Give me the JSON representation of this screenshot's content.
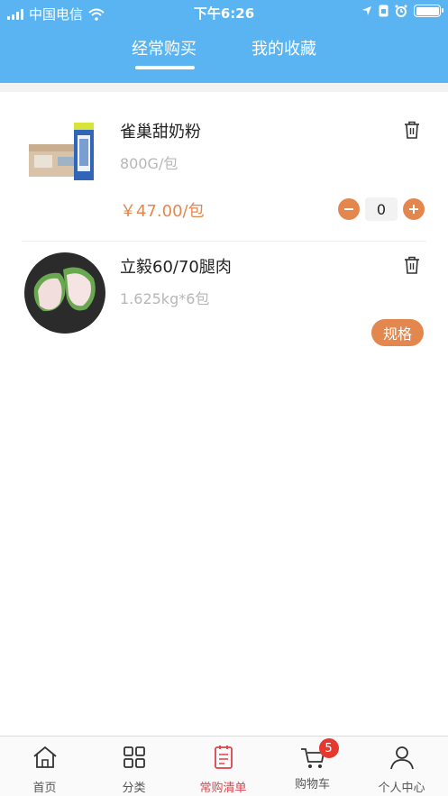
{
  "status_bar": {
    "carrier": "中国电信",
    "time": "下午6:26"
  },
  "tabs": [
    {
      "label": "经常购买",
      "active": true
    },
    {
      "label": "我的收藏",
      "active": false
    }
  ],
  "products": [
    {
      "name": "雀巢甜奶粉",
      "spec": "800G/包",
      "price": "￥47.00/包",
      "quantity": "0"
    },
    {
      "name": "立毅60/70腿肉",
      "spec": "1.625kg*6包",
      "spec_button": "规格"
    }
  ],
  "tabbar": {
    "items": [
      {
        "label": "首页",
        "icon": "home-icon"
      },
      {
        "label": "分类",
        "icon": "grid-icon"
      },
      {
        "label": "常购清单",
        "icon": "list-icon",
        "active": true
      },
      {
        "label": "购物车",
        "icon": "cart-icon",
        "badge": "5"
      },
      {
        "label": "个人中心",
        "icon": "user-icon"
      }
    ]
  },
  "colors": {
    "header": "#5AB4F2",
    "accent": "#E4874E",
    "active_tab": "#E0424B",
    "badge": "#E5382F"
  }
}
